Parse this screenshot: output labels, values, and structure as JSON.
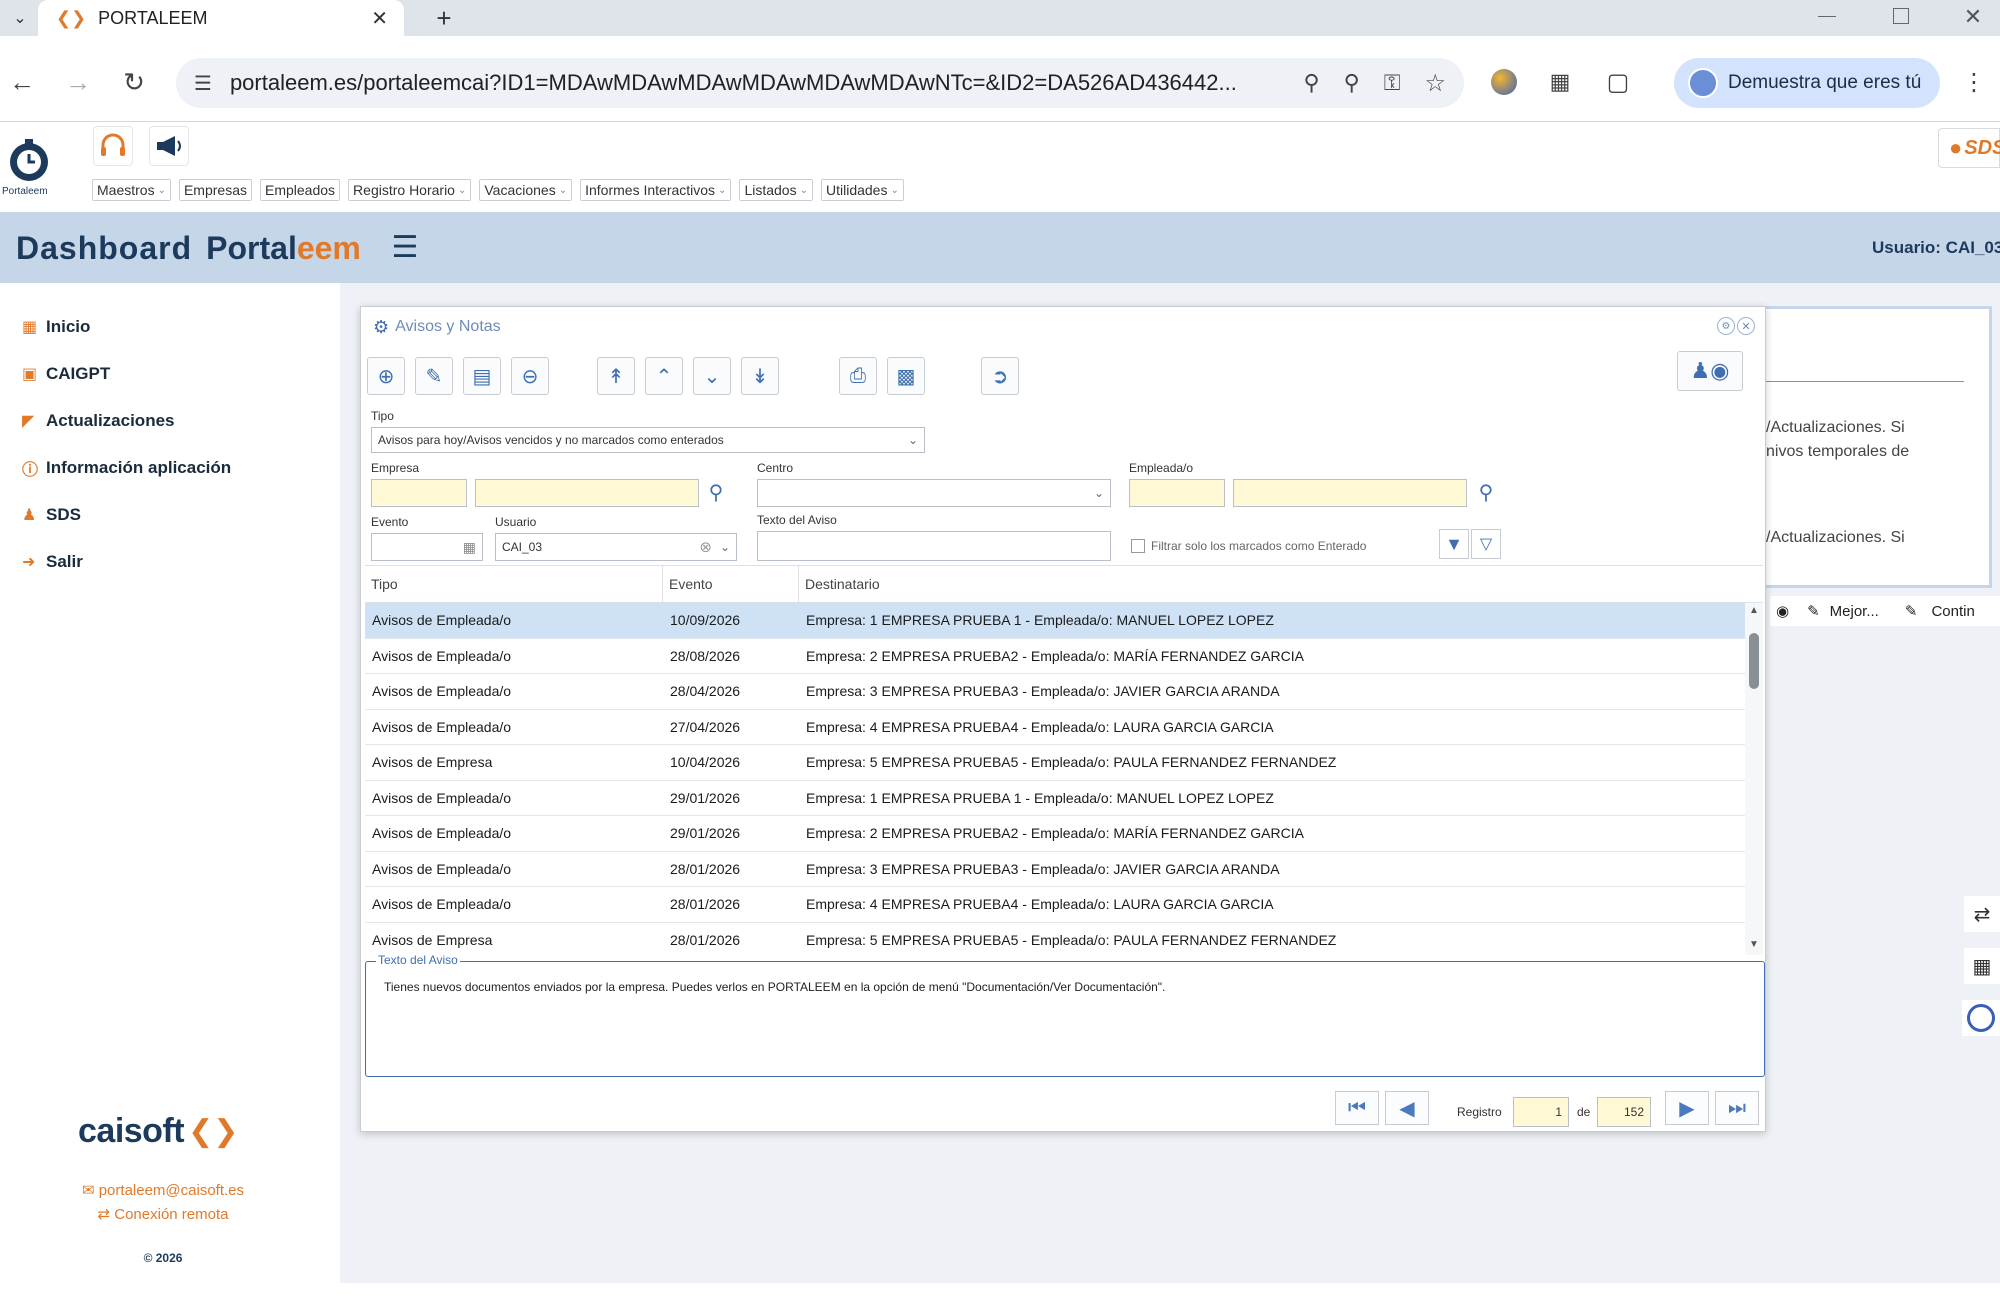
{
  "browser": {
    "tab_title": "PORTALEEM",
    "url": "portaleem.es/portaleemcai?ID1=MDAwMDAwMDAwMDAwMDAwMDAwNTc=&ID2=DA526AD436442...",
    "profile_button": "Demuestra que eres tú"
  },
  "app": {
    "logo_caption": "Portaleem",
    "menu": [
      "Maestros",
      "Empresas",
      "Empleados",
      "Registro Horario",
      "Vacaciones",
      "Informes Interactivos",
      "Listados",
      "Utilidades"
    ],
    "dashboard_title_a": "Dashboard",
    "dashboard_title_b": "Portal",
    "dashboard_title_c": "eem",
    "usuario_label": "Usuario: CAI_03",
    "sds_badge": "SDS"
  },
  "sidebar": {
    "items": [
      {
        "label": "Inicio",
        "icon": "grid-icon"
      },
      {
        "label": "CAIGPT",
        "icon": "chat-icon"
      },
      {
        "label": "Actualizaciones",
        "icon": "megaphone-icon"
      },
      {
        "label": "Información aplicación",
        "icon": "info-icon"
      },
      {
        "label": "SDS",
        "icon": "user-icon"
      },
      {
        "label": "Salir",
        "icon": "logout-icon"
      }
    ],
    "brand": "caisoft",
    "email": "portaleem@caisoft.es",
    "remote": "Conexión remota",
    "copyright": "© 2026"
  },
  "background_panel": {
    "text1a": "/Actualizaciones. Si",
    "text1b": "nivos temporales de",
    "text2": "/Actualizaciones. Si",
    "action_mejor": "Mejor...",
    "action_contin": "Contin"
  },
  "dialog": {
    "title": "Avisos y Notas",
    "tipo_label": "Tipo",
    "tipo_value": "Avisos para hoy/Avisos vencidos y no marcados como enterados",
    "empresa_label": "Empresa",
    "centro_label": "Centro",
    "empleado_label": "Empleada/o",
    "evento_label": "Evento",
    "usuario_label": "Usuario",
    "usuario_value": "CAI_03",
    "texto_label": "Texto del Aviso",
    "filtrar_label": "Filtrar solo los marcados como Enterado",
    "columns": [
      "Tipo",
      "Evento",
      "Destinatario"
    ],
    "rows": [
      [
        "Avisos de Empleada/o",
        "10/09/2026",
        "Empresa: 1 EMPRESA PRUEBA 1 - Empleada/o: MANUEL LOPEZ LOPEZ"
      ],
      [
        "Avisos de Empleada/o",
        "28/08/2026",
        "Empresa: 2 EMPRESA PRUEBA2 - Empleada/o: MARÍA FERNANDEZ GARCIA"
      ],
      [
        "Avisos de Empleada/o",
        "28/04/2026",
        "Empresa: 3 EMPRESA PRUEBA3 - Empleada/o: JAVIER GARCIA ARANDA"
      ],
      [
        "Avisos de Empleada/o",
        "27/04/2026",
        "Empresa: 4 EMPRESA PRUEBA4 - Empleada/o: LAURA GARCIA GARCIA"
      ],
      [
        "Avisos de Empresa",
        "10/04/2026",
        "Empresa: 5 EMPRESA PRUEBA5 - Empleada/o: PAULA FERNANDEZ FERNANDEZ"
      ],
      [
        "Avisos de Empleada/o",
        "29/01/2026",
        "Empresa: 1 EMPRESA PRUEBA 1 - Empleada/o: MANUEL LOPEZ LOPEZ"
      ],
      [
        "Avisos de Empleada/o",
        "29/01/2026",
        "Empresa: 2 EMPRESA PRUEBA2 - Empleada/o: MARÍA FERNANDEZ GARCIA"
      ],
      [
        "Avisos de Empleada/o",
        "28/01/2026",
        "Empresa: 3 EMPRESA PRUEBA3 - Empleada/o: JAVIER GARCIA ARANDA"
      ],
      [
        "Avisos de Empleada/o",
        "28/01/2026",
        "Empresa: 4 EMPRESA PRUEBA4 - Empleada/o: LAURA GARCIA GARCIA"
      ],
      [
        "Avisos de Empresa",
        "28/01/2026",
        "Empresa: 5 EMPRESA PRUEBA5 - Empleada/o: PAULA FERNANDEZ FERNANDEZ"
      ]
    ],
    "aviso_legend": "Texto del Aviso",
    "aviso_text": "Tienes nuevos documentos enviados por la empresa. Puedes verlos en PORTALEEM en la opción de menú \"Documentación/Ver Documentación\".",
    "registro_label": "Registro",
    "registro_value": "1",
    "de_label": "de",
    "total_value": "152"
  },
  "colors": {
    "accent_orange": "#e07a2a",
    "navy": "#1c3a5c",
    "header_blue": "#c5d6e8",
    "selection": "#cfe1f5"
  }
}
